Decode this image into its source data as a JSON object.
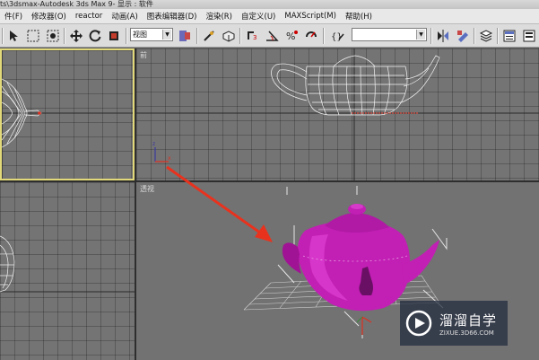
{
  "window": {
    "title_left": "ts\\3dsmax",
    "title_sep": " - ",
    "app_name": "Autodesk 3ds Max 9",
    "display_label": " - 显示 : 软件"
  },
  "menu": {
    "items": [
      {
        "label": "件(F)"
      },
      {
        "label": "修改器(O)"
      },
      {
        "label": "reactor"
      },
      {
        "label": "动画(A)"
      },
      {
        "label": "图表编辑器(D)"
      },
      {
        "label": "渲染(R)"
      },
      {
        "label": "自定义(U)"
      },
      {
        "label": "MAXScript(M)"
      },
      {
        "label": "帮助(H)"
      }
    ]
  },
  "toolbar": {
    "reference_coord": "视图",
    "named_selection": "",
    "icons": [
      "select-object-icon",
      "select-region-icon",
      "select-by-name-icon",
      "move-icon",
      "rotate-icon",
      "scale-icon",
      "link-icon",
      "snap-icon",
      "angle-snap-icon",
      "percent-snap-icon",
      "spinner-snap-icon",
      "mirror-icon",
      "align-icon",
      "layer-icon",
      "material-editor-icon",
      "render-scene-icon"
    ]
  },
  "viewports": {
    "top_left": {
      "label": ""
    },
    "top_right": {
      "label": "前"
    },
    "bottom_left": {
      "label": ""
    },
    "bottom_right": {
      "label": "透视"
    }
  },
  "scene": {
    "object_color": "#c21fb4",
    "wire_color": "#f0f0f0",
    "annotation_color": "#e8321e"
  },
  "watermark": {
    "title": "溜溜自学",
    "subtitle": "ZIXUE.3D66.COM"
  }
}
